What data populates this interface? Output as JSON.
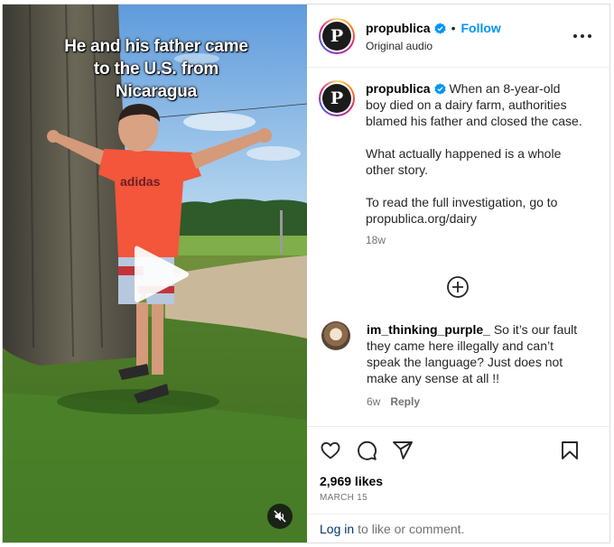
{
  "video": {
    "caption_lines": [
      "He and his father came",
      "to the U.S. from",
      "Nicaragua"
    ],
    "shirt_text": "adidas"
  },
  "header": {
    "username": "propublica",
    "avatar_letter": "P",
    "separator": "•",
    "follow_label": "Follow",
    "audio_label": "Original audio"
  },
  "post": {
    "username": "propublica",
    "text_first": "When an 8-year-old boy died on a dairy farm, authorities blamed his father and closed the case.",
    "text_second": "What actually happened is a whole other story.",
    "text_third": "To read the full investigation, go to propublica.org/dairy",
    "age": "18w"
  },
  "comment": {
    "username": "im_thinking_purple_",
    "text": "So it’s our fault they came here illegally and can’t speak the language? Just does not make any sense at all !!",
    "age": "6w",
    "reply_label": "Reply"
  },
  "engagement": {
    "likes": "2,969 likes",
    "date": "MARCH 15"
  },
  "footer": {
    "login_label": "Log in",
    "login_suffix": "to like or comment."
  },
  "icons": [
    "play-icon",
    "mute-icon",
    "verified-icon",
    "more-options-icon",
    "add-comment-icon",
    "heart-icon",
    "comment-icon",
    "share-icon",
    "bookmark-icon"
  ],
  "colors": {
    "accent": "#0095f6",
    "verified": "#0095f6",
    "link_dark": "#00376b",
    "muted": "#737373"
  }
}
